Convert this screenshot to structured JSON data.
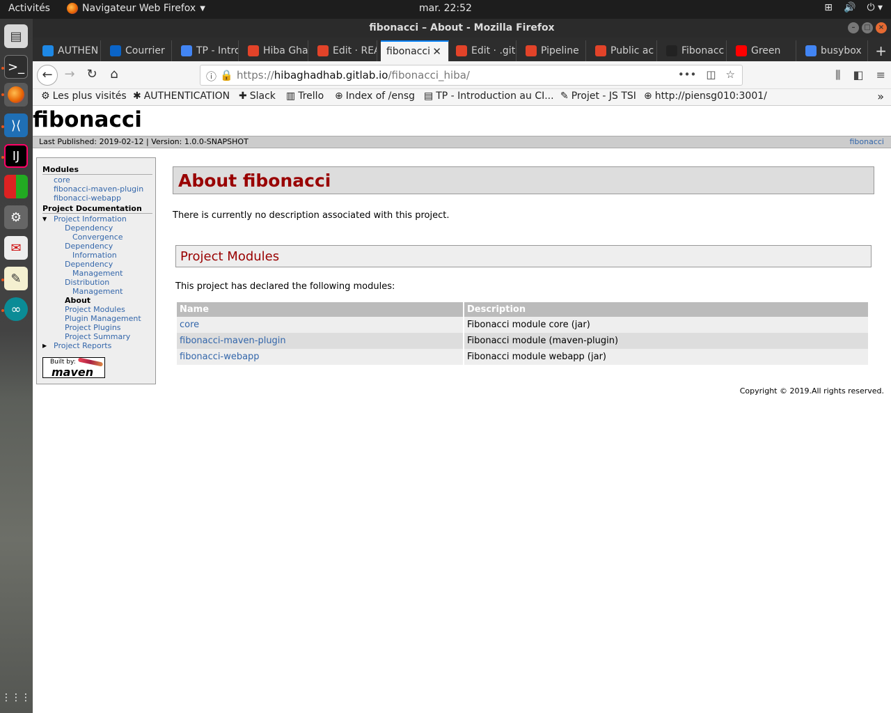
{
  "os": {
    "activities": "Activités",
    "app_name": "Navigateur Web Firefox",
    "clock": "mar. 22:52"
  },
  "window": {
    "title": "fibonacci – About - Mozilla Firefox"
  },
  "tabs": [
    {
      "label": "AUTHEN",
      "icon": "puzzle-icon",
      "color": "#1e88e5"
    },
    {
      "label": "Courrier",
      "icon": "outlook-icon",
      "color": "#0a64c8"
    },
    {
      "label": "TP - Intro",
      "icon": "docs-icon",
      "color": "#4285f4"
    },
    {
      "label": "Hiba Gha",
      "icon": "gitlab-icon",
      "color": "#e24329"
    },
    {
      "label": "Edit · REA",
      "icon": "gitlab-icon",
      "color": "#e24329"
    },
    {
      "label": "fibonacci",
      "icon": "",
      "color": ""
    },
    {
      "label": "Edit · .git",
      "icon": "gitlab-icon",
      "color": "#e24329"
    },
    {
      "label": "Pipeline",
      "icon": "pipeline-icon",
      "color": "#e24329"
    },
    {
      "label": "Public ac",
      "icon": "gitlab-icon",
      "color": "#e24329"
    },
    {
      "label": "Fibonacc",
      "icon": "github-icon",
      "color": "#222"
    },
    {
      "label": "Green",
      "icon": "youtube-icon",
      "color": "#f00"
    },
    {
      "label": "busybox",
      "icon": "google-icon",
      "color": "#4285f4"
    }
  ],
  "url": {
    "prefix": "https://",
    "host": "hibaghadhab.gitlab.io",
    "path": "/fibonacci_hiba/"
  },
  "bookmarks": [
    {
      "label": "Les plus visités",
      "icon": "gear-icon"
    },
    {
      "label": "AUTHENTICATION",
      "icon": "puzzle-icon"
    },
    {
      "label": "Slack",
      "icon": "slack-icon"
    },
    {
      "label": "Trello",
      "icon": "trello-icon"
    },
    {
      "label": "Index of /ensg",
      "icon": "globe-icon"
    },
    {
      "label": "TP - Introduction au CI...",
      "icon": "docs-icon"
    },
    {
      "label": "Projet - JS TSI",
      "icon": "notebook-icon"
    },
    {
      "label": "http://piensg010:3001/",
      "icon": "globe-icon"
    }
  ],
  "page": {
    "site_title": "fibonacci",
    "last_published": "Last Published: 2019-02-12  | Version: 1.0.0-SNAPSHOT",
    "crumb_right": "fibonacci",
    "sidebar": {
      "modules_heading": "Modules",
      "modules": [
        "core",
        "fibonacci-maven-plugin",
        "fibonacci-webapp"
      ],
      "docs_heading": "Project Documentation",
      "project_information": "Project Information",
      "items": [
        {
          "lines": [
            "Dependency",
            "Convergence"
          ],
          "current": false
        },
        {
          "lines": [
            "Dependency",
            "Information"
          ],
          "current": false
        },
        {
          "lines": [
            "Dependency",
            "Management"
          ],
          "current": false
        },
        {
          "lines": [
            "Distribution",
            "Management"
          ],
          "current": false
        },
        {
          "lines": [
            "About"
          ],
          "current": true
        },
        {
          "lines": [
            "Project Modules"
          ],
          "current": false
        },
        {
          "lines": [
            "Plugin Management"
          ],
          "current": false
        },
        {
          "lines": [
            "Project Plugins"
          ],
          "current": false
        },
        {
          "lines": [
            "Project Summary"
          ],
          "current": false
        }
      ],
      "project_reports": "Project Reports",
      "built_by": "Built by:",
      "maven": "maven"
    },
    "about_heading": "About fibonacci",
    "description": "There is currently no description associated with this project.",
    "modules_heading": "Project Modules",
    "modules_intro": "This project has declared the following modules:",
    "table": {
      "headers": [
        "Name",
        "Description"
      ],
      "rows": [
        [
          "core",
          "Fibonacci module core (jar)"
        ],
        [
          "fibonacci-maven-plugin",
          "Fibonacci module (maven-plugin)"
        ],
        [
          "fibonacci-webapp",
          "Fibonacci module webapp (jar)"
        ]
      ]
    },
    "copyright": "Copyright © 2019.All rights reserved."
  }
}
